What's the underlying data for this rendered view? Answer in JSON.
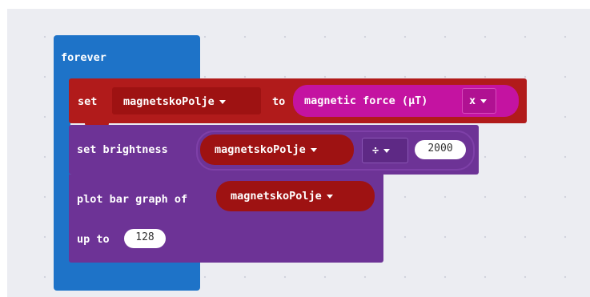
{
  "forever_label": "forever",
  "set_block": {
    "set_label": "set",
    "variable": "magnetskoPolje",
    "to_label": "to",
    "reporter_label": "magnetic force (µT)",
    "axis": "x"
  },
  "brightness_block": {
    "label": "set brightness",
    "variable": "magnetskoPolje",
    "operator": "÷",
    "value": "2000"
  },
  "plot_block": {
    "label": "plot bar graph of",
    "variable": "magnetskoPolje",
    "up_to_label": "up to",
    "up_to_value": "128"
  },
  "colors": {
    "workspace": "#ecedf2",
    "loops": "#1e73c8",
    "variables": "#b11b1b",
    "input": "#c413a1",
    "led": "#6d3396"
  }
}
